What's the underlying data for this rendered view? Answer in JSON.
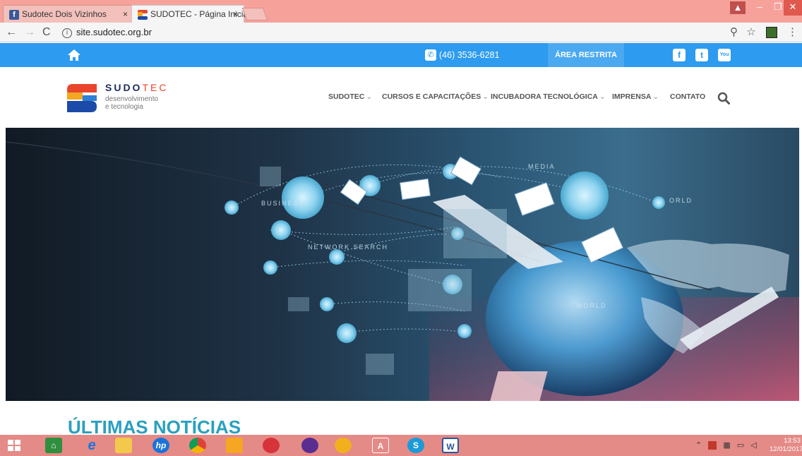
{
  "browser": {
    "tabs": [
      {
        "label": "Sudotec Dois Vizinhos",
        "close": "×"
      },
      {
        "label": "SUDOTEC - Página Inicial",
        "close": "×"
      }
    ],
    "url": "site.sudotec.org.br",
    "info_icon": "i"
  },
  "topbar": {
    "phone": "(46) 3536-6281",
    "restricted_label": "ÁREA RESTRITA",
    "social": [
      "f",
      "t",
      "You"
    ]
  },
  "brand": {
    "name_a": "SUDO",
    "name_b": "TEC",
    "tagline_1": "desenvolvimento",
    "tagline_2": "e tecnologia"
  },
  "nav": {
    "items": [
      {
        "label": "SUDOTEC",
        "caret": "⌄"
      },
      {
        "label": "CURSOS E CAPACITAÇÕES",
        "caret": "⌄"
      },
      {
        "label": "INCUBADORA TECNOLÓGICA",
        "caret": "⌄"
      },
      {
        "label": "IMPRENSA",
        "caret": "⌄"
      },
      {
        "label": "CONTATO",
        "caret": ""
      }
    ]
  },
  "banner": {
    "overlay_texts": [
      "MEDIA",
      "NETWORK SEARCH",
      "BUSINESS",
      "WORLD",
      "ORLD"
    ]
  },
  "section": {
    "title": "ÚLTIMAS NOTÍCIAS"
  },
  "taskbar": {
    "apps": [
      "start",
      "store",
      "ie",
      "files",
      "hp",
      "chrome",
      "photos",
      "app-red",
      "app-purple",
      "app-yellow",
      "app-outline",
      "skype",
      "word"
    ],
    "time": "13:53",
    "date": "12/01/2017"
  },
  "colors": {
    "topbar": "#2d9bef",
    "accent_title": "#2aa0bf",
    "tabstrip": "#f6a29b",
    "taskbar": "#e48a87"
  }
}
